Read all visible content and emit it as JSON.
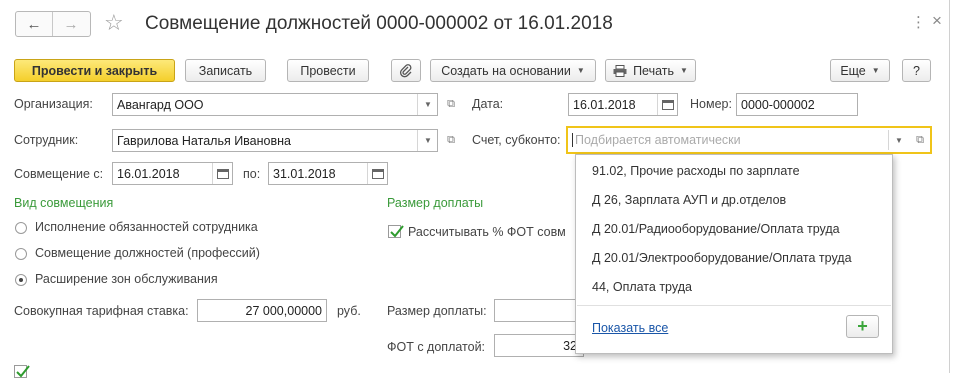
{
  "header": {
    "back": "←",
    "forward": "→",
    "star": "☆",
    "title": "Совмещение должностей 0000-000002 от 16.01.2018",
    "more": "⋮",
    "close": "×"
  },
  "toolbar": {
    "post_close": "Провести и закрыть",
    "save": "Записать",
    "post": "Провести",
    "create_based": "Создать на основании",
    "print": "Печать",
    "more": "Еще",
    "help": "?"
  },
  "form": {
    "org_label": "Организация:",
    "org_value": "Авангард ООО",
    "date_label": "Дата:",
    "date_value": "16.01.2018",
    "number_label": "Номер:",
    "number_value": "0000-000002",
    "employee_label": "Сотрудник:",
    "employee_value": "Гаврилова Наталья Ивановна",
    "account_label": "Счет, субконто:",
    "account_placeholder": "Подбирается автоматически",
    "from_label": "Совмещение с:",
    "from_value": "16.01.2018",
    "to_label": "по:",
    "to_value": "31.01.2018",
    "kind_section": "Вид совмещения",
    "radio1": "Исполнение обязанностей сотрудника",
    "radio2": "Совмещение должностей (профессий)",
    "radio3": "Расширение зон обслуживания",
    "size_section": "Размер доплаты",
    "calc_fot_label": "Рассчитывать % ФОТ совм",
    "rate_label": "Совокупная тарифная ставка:",
    "rate_value": "27 000,00000",
    "rate_unit": "руб.",
    "extra_label": "Размер доплаты:",
    "fot_label": "ФОТ с доплатой:",
    "fot_value": "32"
  },
  "dropdown": {
    "items": [
      "91.02, Прочие расходы по зарплате",
      "Д 26, Зарплата АУП и др.отделов",
      "Д 20.01/Радиооборудование/Оплата труда",
      "Д 20.01/Электрооборудование/Оплата труда",
      "44, Оплата труда"
    ],
    "show_all": "Показать все",
    "add": "+"
  },
  "colors": {
    "primary_button": "#f4cf2b",
    "focus_border": "#f0c419",
    "section_green": "#3a9a3a",
    "link_blue": "#1a56a8"
  }
}
